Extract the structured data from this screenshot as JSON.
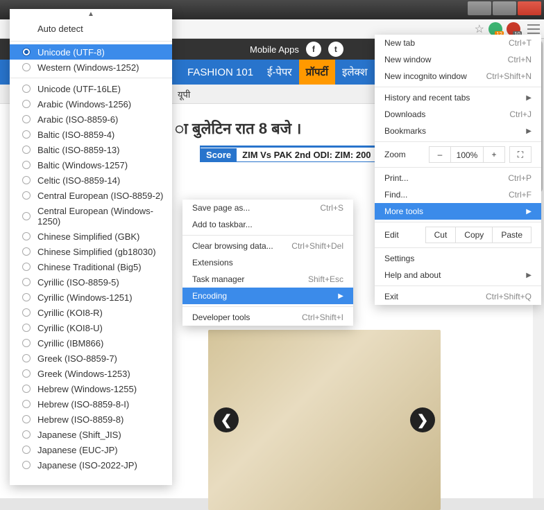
{
  "browser": {
    "controls": [
      "min",
      "max",
      "close"
    ]
  },
  "toolbar": {
    "hamburger": "menu"
  },
  "page": {
    "mobile_apps": "Mobile Apps",
    "social": {
      "fb": "f",
      "tw": "t"
    },
    "cats": {
      "fashion": "FASHION 101",
      "epaper": "ई-पेपर",
      "property": "प्रॉपर्टी",
      "election": "इलेक्श"
    },
    "sub": "यूपी",
    "headline": "ा बुलेटिन रात 8 बजे ।",
    "score_label": "Score",
    "score_text": "ZIM Vs PAK 2nd ODI: ZIM: 200"
  },
  "chrome_menu": {
    "new_tab": "New tab",
    "new_tab_sc": "Ctrl+T",
    "new_window": "New window",
    "new_window_sc": "Ctrl+N",
    "incognito": "New incognito window",
    "incognito_sc": "Ctrl+Shift+N",
    "history": "History and recent tabs",
    "downloads": "Downloads",
    "downloads_sc": "Ctrl+J",
    "bookmarks": "Bookmarks",
    "zoom": "Zoom",
    "zoom_minus": "–",
    "zoom_val": "100%",
    "zoom_plus": "+",
    "print": "Print...",
    "print_sc": "Ctrl+P",
    "find": "Find...",
    "find_sc": "Ctrl+F",
    "more_tools": "More tools",
    "edit": "Edit",
    "cut": "Cut",
    "copy": "Copy",
    "paste": "Paste",
    "settings": "Settings",
    "help": "Help and about",
    "exit": "Exit",
    "exit_sc": "Ctrl+Shift+Q"
  },
  "more_tools_menu": {
    "save_as": "Save page as...",
    "save_as_sc": "Ctrl+S",
    "taskbar": "Add to taskbar...",
    "clear": "Clear browsing data...",
    "clear_sc": "Ctrl+Shift+Del",
    "extensions": "Extensions",
    "task_mgr": "Task manager",
    "task_mgr_sc": "Shift+Esc",
    "encoding": "Encoding",
    "devtools": "Developer tools",
    "devtools_sc": "Ctrl+Shift+I"
  },
  "encoding": {
    "auto": "Auto detect",
    "items": [
      "Unicode (UTF-8)",
      "Western (Windows-1252)",
      "Unicode (UTF-16LE)",
      "Arabic (Windows-1256)",
      "Arabic (ISO-8859-6)",
      "Baltic (ISO-8859-4)",
      "Baltic (ISO-8859-13)",
      "Baltic (Windows-1257)",
      "Celtic (ISO-8859-14)",
      "Central European (ISO-8859-2)",
      "Central European (Windows-1250)",
      "Chinese Simplified (GBK)",
      "Chinese Simplified (gb18030)",
      "Chinese Traditional (Big5)",
      "Cyrillic (ISO-8859-5)",
      "Cyrillic (Windows-1251)",
      "Cyrillic (KOI8-R)",
      "Cyrillic (KOI8-U)",
      "Cyrillic (IBM866)",
      "Greek (ISO-8859-7)",
      "Greek (Windows-1253)",
      "Hebrew (Windows-1255)",
      "Hebrew (ISO-8859-8-I)",
      "Hebrew (ISO-8859-8)",
      "Japanese (Shift_JIS)",
      "Japanese (EUC-JP)",
      "Japanese (ISO-2022-JP)"
    ],
    "selected_index": 0
  }
}
